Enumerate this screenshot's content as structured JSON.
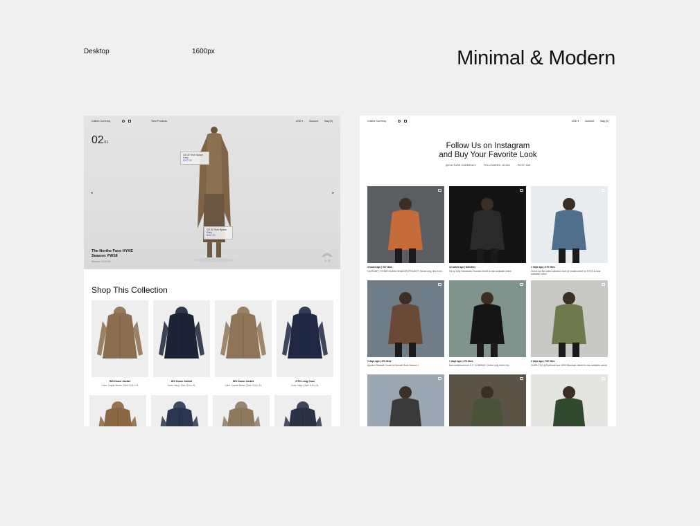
{
  "header": {
    "device_label": "Desktop",
    "width_label": "1600px",
    "title": "Minimal & Modern"
  },
  "left": {
    "nav": {
      "brand": "Culture Currency",
      "link": "View Products",
      "currency": "USD ▾",
      "account": "Account",
      "bag": "Bag (0)"
    },
    "hero": {
      "counter": "02",
      "counter_total": "/11",
      "prev": "◂",
      "next": "▸",
      "caption_line1": "The Northe Face HYKE",
      "caption_line2": "Season: FW18",
      "date": "Season: 10.09.18",
      "page_indicator": "4 / 11",
      "tag1": {
        "name": "CB 02 Tech Space Grey",
        "price": "$247.00"
      },
      "tag2": {
        "name": "CB 02 Tech Space Grey",
        "price": "$247.00"
      }
    },
    "shop_title": "Shop This Collection",
    "products": [
      {
        "name": "WS Down Jacket",
        "meta": "Color: Coyote Brown | Size: S,M,L,XL",
        "color": "#8a6e4d"
      },
      {
        "name": "WS Down Jacket",
        "meta": "Color: Navy | Size: S,M,L,XL",
        "color": "#1c2336"
      },
      {
        "name": "WS Down Jacket",
        "meta": "Color: Coyote Brown | Size: S,M,L,XL",
        "color": "#8e7557"
      },
      {
        "name": "GTX Long Coat",
        "meta": "Color: Navy | Size: S,M,L,XL",
        "color": "#1f2742"
      },
      {
        "name": "",
        "meta": "",
        "color": "#8a6642"
      },
      {
        "name": "",
        "meta": "",
        "color": "#2a3550"
      },
      {
        "name": "",
        "meta": "",
        "color": "#8d7a5e"
      },
      {
        "name": "",
        "meta": "",
        "color": "#2b3245"
      }
    ]
  },
  "right": {
    "nav": {
      "brand": "Culture Currency",
      "currency": "USD ▾",
      "account": "Account",
      "bag": "Bag (0)"
    },
    "title_line1": "Follow Us on Instagram",
    "title_line2": "and Buy Your Favorite Look",
    "stats": {
      "handle": "@CULTURE CURRENCY",
      "followers": "FOLLOWERS: 10,253",
      "posts": "POST: 169"
    },
    "posts": [
      {
        "meta1": "3 hours ago | 207 likes",
        "meta2": "CAKTAMP | STONE ISLAND SHADOW PROJECT. Online only, link in bio.",
        "bg": "#5a5e63",
        "fig": "#c66b3a"
      },
      {
        "meta1": "12 hours ago | 825 likes",
        "meta2": "It's by Yohji Yamamoto Pour.aes 03/18 is now available online",
        "bg": "#141414",
        "fig": "#2a2a2a"
      },
      {
        "meta1": "1 days ago | 370 likes",
        "meta2": "Check out the latest collection from @ sindshomme for HYKE is now available online",
        "bg": "#e9ecef",
        "fig": "#4f6f8c"
      },
      {
        "meta1": "1 days ago | 370 likes",
        "meta2": "Special 'Release' Coats by Samuel Ross Season 1",
        "bg": "#6f7d88",
        "fig": "#6a4a36"
      },
      {
        "meta1": "1 days ago | 370 likes",
        "meta2": "New deliveries from C.P. COMPANY. Online only, link in bio.",
        "bg": "#7f948c",
        "fig": "#151515"
      },
      {
        "meta1": "3 days ago | 760 likes",
        "meta2": "GORE-TEX @TheNorthFace 1990 Mountain Jacket is now available online",
        "bg": "#c8c8c4",
        "fig": "#6f7a4c"
      },
      {
        "meta1": "",
        "meta2": "",
        "bg": "#9aa6b2",
        "fig": "#3a3a3a"
      },
      {
        "meta1": "",
        "meta2": "",
        "bg": "#5a5346",
        "fig": "#4a5238"
      },
      {
        "meta1": "",
        "meta2": "",
        "bg": "#e4e4e0",
        "fig": "#2f4a2c"
      }
    ]
  }
}
